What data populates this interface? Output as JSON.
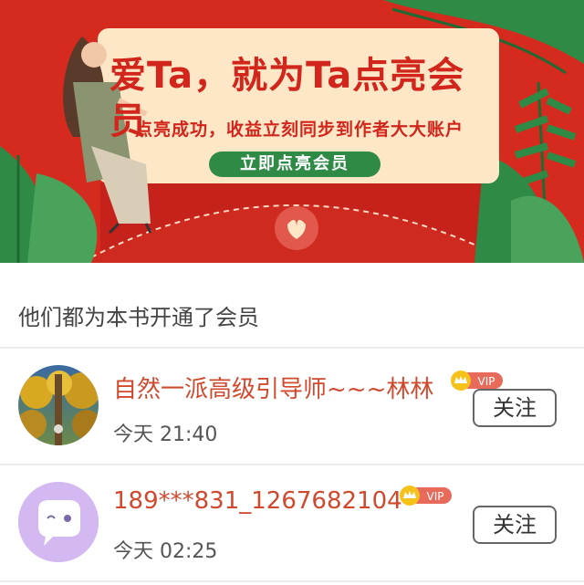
{
  "banner": {
    "headline": "爱Ta，就为Ta点亮会员",
    "subline": "点亮成功，收益立刻同步到作者大大账户",
    "cta_label": "立即点亮会员"
  },
  "section": {
    "title": "他们都为本书开通了会员"
  },
  "members": [
    {
      "name": "自然一派高级引导师~~~林林",
      "badge": "VIP",
      "time": "今天 21:40",
      "follow_label": "关注"
    },
    {
      "name": "189***831_1267682104",
      "badge": "VIP",
      "time": "今天 02:25",
      "follow_label": "关注"
    }
  ],
  "colors": {
    "accent": "#d0492e",
    "banner_red": "#d52a1e",
    "cta_green": "#2f8a46",
    "card": "#fde7c7"
  }
}
